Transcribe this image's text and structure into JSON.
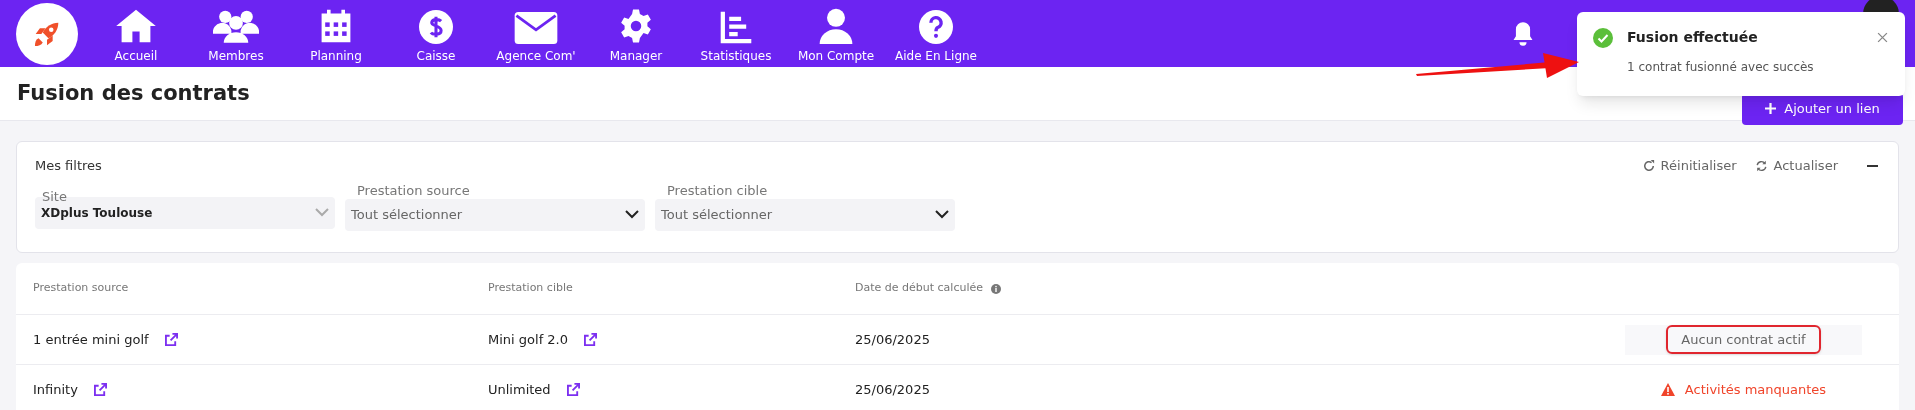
{
  "nav": {
    "items": [
      {
        "label": "Accueil"
      },
      {
        "label": "Membres"
      },
      {
        "label": "Planning"
      },
      {
        "label": "Caisse"
      },
      {
        "label": "Agence Com'"
      },
      {
        "label": "Manager"
      },
      {
        "label": "Statistiques"
      },
      {
        "label": "Mon Compte"
      },
      {
        "label": "Aide En Ligne"
      }
    ]
  },
  "page": {
    "title": "Fusion des contrats",
    "add_button": "Ajouter un lien"
  },
  "toast": {
    "title": "Fusion effectuée",
    "message": "1 contrat fusionné avec succès"
  },
  "filters": {
    "title": "Mes filtres",
    "reset": "Réinitialiser",
    "refresh": "Actualiser",
    "fields": [
      {
        "label": "Site",
        "value": "XDplus Toulouse",
        "kind": "filled"
      },
      {
        "label": "Prestation source",
        "value": "Tout sélectionner",
        "kind": "empty"
      },
      {
        "label": "Prestation cible",
        "value": "Tout sélectionner",
        "kind": "empty"
      }
    ]
  },
  "table": {
    "columns": [
      "Prestation source",
      "Prestation cible",
      "Date de début calculée"
    ],
    "rows": [
      {
        "source": "1 entrée mini golf",
        "target": "Mini golf 2.0",
        "date": "25/06/2025",
        "status": "Aucun contrat actif",
        "kind": "inactive",
        "highlighted": true
      },
      {
        "source": "Infinity",
        "target": "Unlimited",
        "date": "25/06/2025",
        "status": "Activités manquantes",
        "kind": "warning",
        "highlighted": false
      }
    ]
  }
}
